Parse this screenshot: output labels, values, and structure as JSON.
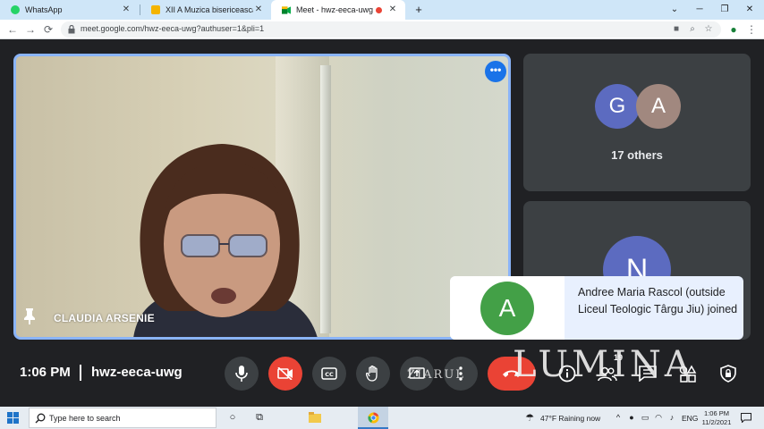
{
  "browser": {
    "tabs": [
      {
        "title": "WhatsApp",
        "close": "✕"
      },
      {
        "title": "XII A Muzica bisericeasca si Ghid",
        "close": "✕"
      },
      {
        "title": "Meet - hwz-eeca-uwg",
        "close": "✕"
      }
    ],
    "new_tab": "+",
    "window_controls": {
      "dropdown": "⌄",
      "minimize": "─",
      "restore": "❐",
      "close": "✕"
    },
    "url": "meet.google.com/hwz-eeca-uwg?authuser=1&pli=1"
  },
  "meet": {
    "main_participant": {
      "name": "CLAUDIA ARSENIE"
    },
    "more_options": "•••",
    "side_tiles": [
      {
        "avatars": [
          {
            "letter": "G",
            "color": "#5c6bc0"
          },
          {
            "letter": "A",
            "color": "#a1887f"
          }
        ],
        "label": "17 others"
      },
      {
        "avatars": [
          {
            "letter": "N",
            "color": "#5c6bc0"
          }
        ]
      }
    ],
    "toast": {
      "avatar_letter": "A",
      "avatar_color": "#43a047",
      "message": "Andree Maria Rascol (outside Liceul Teologic Târgu Jiu) joined"
    },
    "controls": {
      "time": "1:06 PM",
      "meeting_code": "hwz-eeca-uwg",
      "participants_count": "19"
    },
    "watermark": {
      "small": "ZIARUL",
      "big": "LUMINA"
    }
  },
  "taskbar": {
    "search_placeholder": "Type here to search",
    "weather": "47°F  Raining now",
    "language": "ENG",
    "time": "1:06 PM",
    "date": "11/2/2021"
  },
  "colors": {
    "accent_blue": "#8ab4f8",
    "red": "#ea4335",
    "meet_bg": "#202124",
    "tile_bg": "#3c4043"
  }
}
